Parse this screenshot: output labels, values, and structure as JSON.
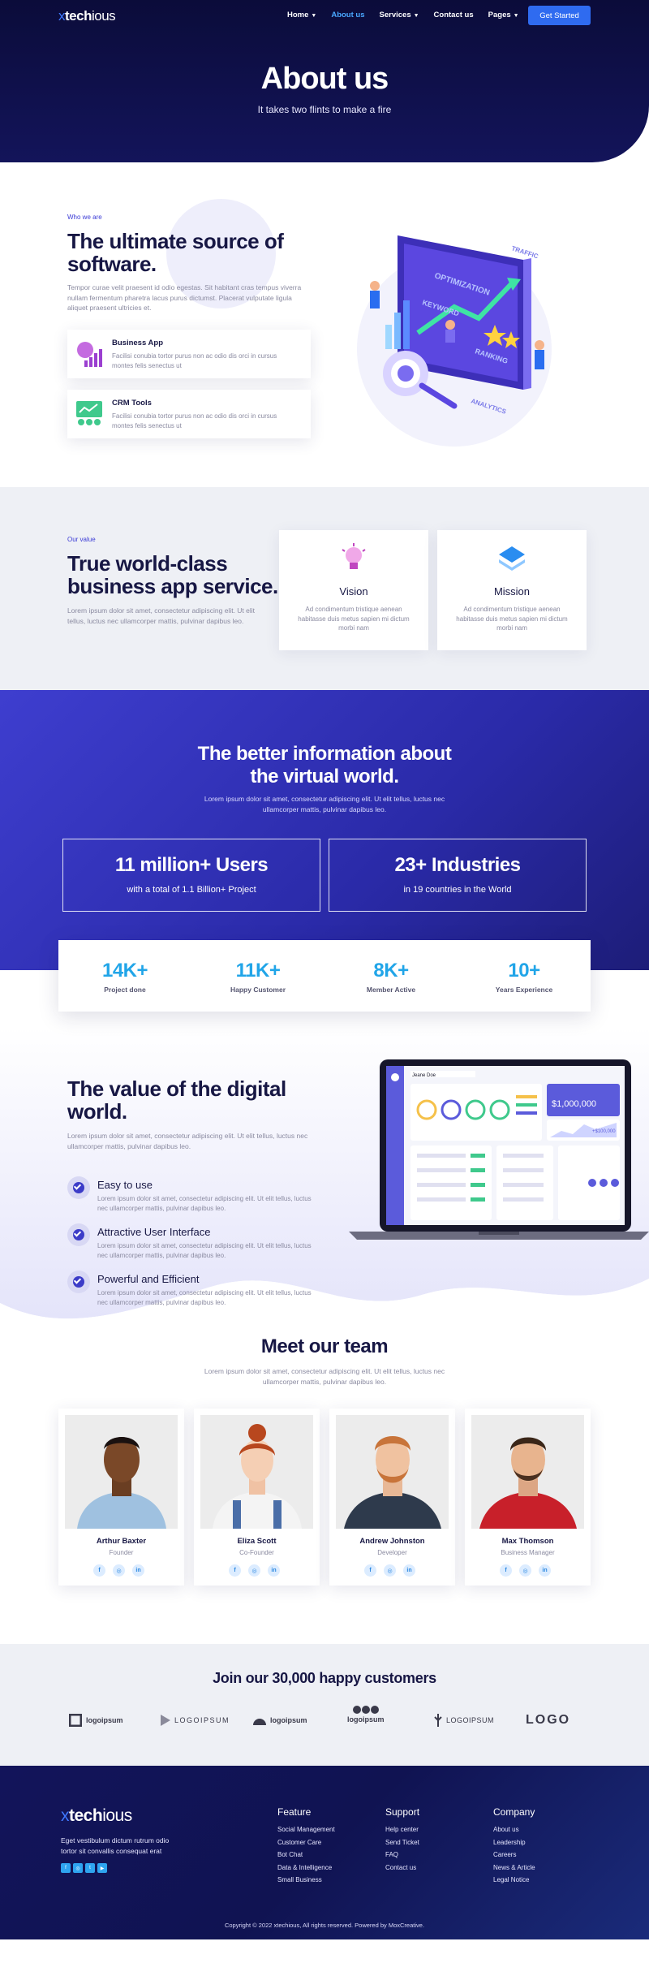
{
  "nav": {
    "logo_prefix": "x",
    "logo_brand": "tech",
    "logo_suffix": "ious",
    "items": [
      {
        "label": "Home",
        "caret": true
      },
      {
        "label": "About us",
        "caret": false,
        "active": true
      },
      {
        "label": "Services",
        "caret": true
      },
      {
        "label": "Contact us",
        "caret": false
      },
      {
        "label": "Pages",
        "caret": true
      }
    ],
    "cta": "Get Started"
  },
  "hero": {
    "title": "About us",
    "subtitle": "It takes two flints to make a fire"
  },
  "about": {
    "eyebrow": "Who we are",
    "title": "The ultimate source of software.",
    "text": "Tempor curae velit praesent id odio egestas. Sit habitant cras tempus viverra nullam fermentum pharetra lacus purus dictumst. Placerat vulputate ligula aliquet praesent ultricies et.",
    "features": [
      {
        "title": "Business App",
        "text": "Facilisi conubia tortor purus non ac odio dis orci in cursus montes felis senectus ut"
      },
      {
        "title": "CRM Tools",
        "text": "Facilisi conubia tortor purus non ac odio dis orci in cursus montes felis senectus ut"
      }
    ],
    "illustration_labels": [
      "OPTIMIZATION",
      "KEYWORD",
      "RANKING",
      "TRAFFIC",
      "ANALYTICS"
    ]
  },
  "value": {
    "eyebrow": "Our value",
    "title": "True world-class business app service.",
    "text": "Lorem ipsum dolor sit amet, consectetur adipiscing elit. Ut elit tellus, luctus nec ullamcorper mattis, pulvinar dapibus leo.",
    "cards": [
      {
        "title": "Vision",
        "text": "Ad condimentum tristique aenean habitasse duis metus sapien mi dictum morbi nam"
      },
      {
        "title": "Mission",
        "text": "Ad condimentum tristique aenean habitasse duis metus sapien mi dictum morbi nam"
      }
    ]
  },
  "stats": {
    "title": "The better information about the virtual world.",
    "text": "Lorem ipsum dolor sit amet, consectetur adipiscing elit. Ut elit tellus, luctus nec ullamcorper mattis, pulvinar dapibus leo.",
    "boxes": [
      {
        "big": "11 million+ Users",
        "small": "with a total of 1.1 Billion+ Project"
      },
      {
        "big": "23+ Industries",
        "small": "in 19 countries in the World"
      }
    ],
    "counters": [
      {
        "number": "14K+",
        "label": "Project done"
      },
      {
        "number": "11K+",
        "label": "Happy Customer"
      },
      {
        "number": "8K+",
        "label": "Member Active"
      },
      {
        "number": "10+",
        "label": "Years Experience"
      }
    ]
  },
  "digital": {
    "title": "The value of the digital world.",
    "text": "Lorem ipsum dolor sit amet, consectetur adipiscing elit. Ut elit tellus, luctus nec ullamcorper mattis, pulvinar dapibus leo.",
    "items": [
      {
        "title": "Easy to use",
        "text": "Lorem ipsum dolor sit amet, consectetur adipiscing elit. Ut elit tellus, luctus nec ullamcorper mattis, pulvinar dapibus leo."
      },
      {
        "title": "Attractive User Interface",
        "text": "Lorem ipsum dolor sit amet, consectetur adipiscing elit. Ut elit tellus, luctus nec ullamcorper mattis, pulvinar dapibus leo."
      },
      {
        "title": "Powerful and Efficient",
        "text": "Lorem ipsum dolor sit amet, consectetur adipiscing elit. Ut elit tellus, luctus nec ullamcorper mattis, pulvinar dapibus leo."
      }
    ],
    "dashboard": {
      "user": "Jeane Doe",
      "balance": "$1,000,000",
      "secondary": "+$100,000"
    }
  },
  "team": {
    "title": "Meet our team",
    "text": "Lorem ipsum dolor sit amet, consectetur adipiscing elit. Ut elit tellus, luctus nec ullamcorper mattis, pulvinar dapibus leo.",
    "members": [
      {
        "name": "Arthur Baxter",
        "role": "Founder"
      },
      {
        "name": "Eliza Scott",
        "role": "Co-Founder"
      },
      {
        "name": "Andrew Johnston",
        "role": "Developer"
      },
      {
        "name": "Max Thomson",
        "role": "Business Manager"
      }
    ],
    "social": [
      "f",
      "◎",
      "in"
    ]
  },
  "customers": {
    "title": "Join our 30,000 happy customers",
    "logos": [
      "logoipsum",
      "LOGOIPSUM",
      "logoipsum",
      "logoipsum",
      "LOGOIPSUM",
      "LOGO"
    ]
  },
  "footer": {
    "logo_prefix": "x",
    "logo_brand": "tech",
    "logo_suffix": "ious",
    "desc": "Eget vestibulum dictum rutrum odio tortor sit convallis consequat erat",
    "columns": [
      {
        "heading": "Feature",
        "items": [
          "Social Management",
          "Customer Care",
          "Bot Chat",
          "Data & Intelligence",
          "Small Business"
        ]
      },
      {
        "heading": "Support",
        "items": [
          "Help center",
          "Send Ticket",
          "FAQ",
          "Contact us"
        ]
      },
      {
        "heading": "Company",
        "items": [
          "About us",
          "Leadership",
          "Careers",
          "News & Article",
          "Legal Notice"
        ]
      }
    ],
    "copyright": "Copyright © 2022 xtechious, All rights reserved. Powered by MoxCreative."
  },
  "colors": {
    "primary": "#3c3cc8",
    "accent": "#2f6bf0",
    "counter": "#21a5e8",
    "navy": "#13145a"
  }
}
